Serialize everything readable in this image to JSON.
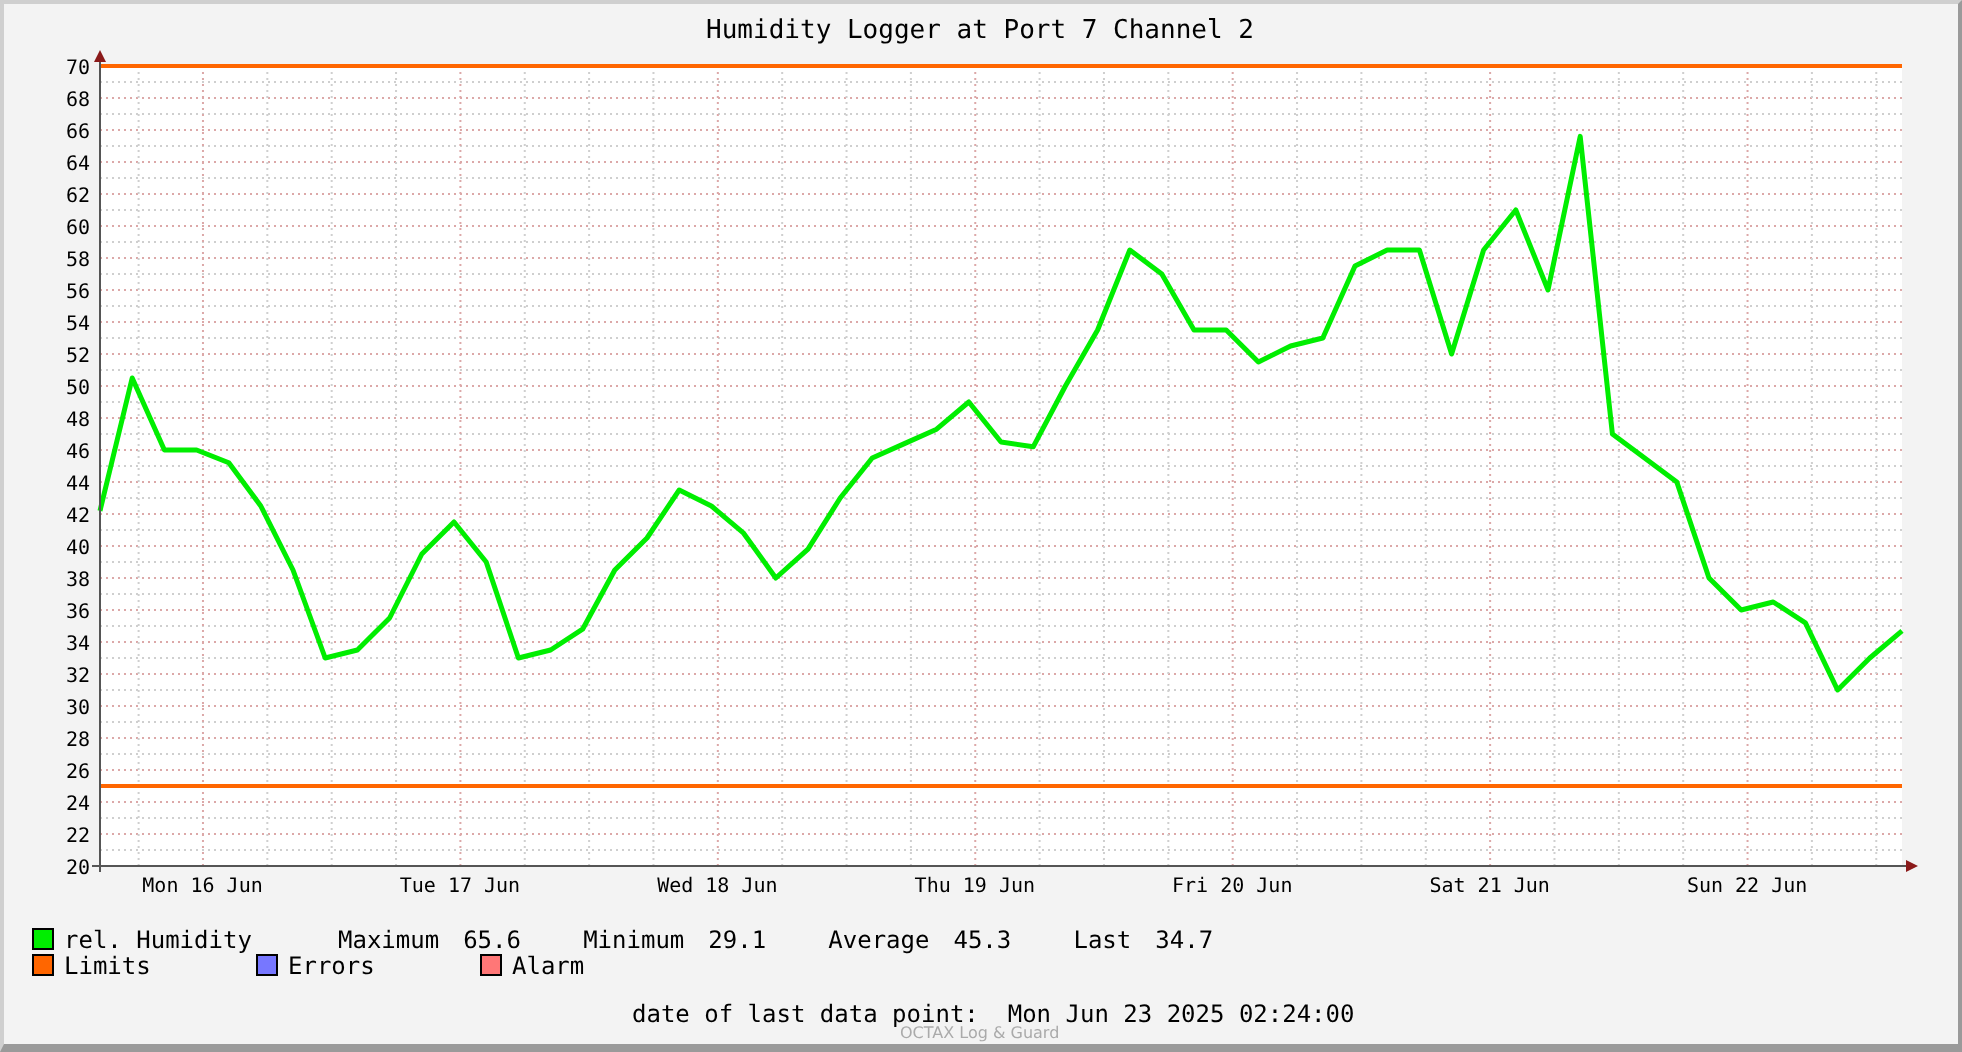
{
  "chart_data": {
    "type": "line",
    "title": "Humidity Logger at Port 7 Channel 2",
    "ylim": [
      20,
      70
    ],
    "categories": [
      null,
      null,
      null,
      "Mon 16 Jun",
      null,
      null,
      null,
      null,
      null,
      null,
      null,
      "Tue 17 Jun",
      null,
      null,
      null,
      null,
      null,
      null,
      null,
      "Wed 18 Jun",
      null,
      null,
      null,
      null,
      null,
      null,
      null,
      "Thu 19 Jun",
      null,
      null,
      null,
      null,
      null,
      null,
      null,
      "Fri 20 Jun",
      null,
      null,
      null,
      null,
      null,
      null,
      null,
      "Sat 21 Jun",
      null,
      null,
      null,
      null,
      null,
      null,
      null,
      "Sun 22 Jun",
      null,
      null,
      null,
      null,
      null
    ],
    "yticks": [
      20,
      22,
      24,
      26,
      28,
      30,
      32,
      34,
      36,
      38,
      40,
      42,
      44,
      46,
      48,
      50,
      52,
      54,
      56,
      58,
      60,
      62,
      64,
      66,
      68,
      70
    ],
    "series": [
      {
        "name": "rel. Humidity",
        "color": "#00ee00",
        "values": [
          42.2,
          50.5,
          46,
          46,
          45.2,
          42.5,
          38.5,
          33,
          33.5,
          35.5,
          39.5,
          41.5,
          39,
          33,
          33.5,
          34.8,
          38.5,
          40.5,
          43.5,
          42.5,
          40.8,
          38,
          39.8,
          43,
          45.5,
          46.4,
          47.3,
          49,
          46.5,
          46.2,
          50,
          53.5,
          58.5,
          57,
          53.5,
          53.5,
          51.5,
          52.5,
          53,
          57.5,
          58.5,
          58.5,
          52,
          58.5,
          61,
          56,
          65.6,
          47,
          45.5,
          44,
          38,
          36,
          36.5,
          35.2,
          31,
          33,
          34.7
        ]
      },
      {
        "name": "Limits",
        "color": "#ff6600",
        "values": [
          70,
          70,
          70,
          70,
          70,
          70,
          70,
          70,
          70,
          70,
          70,
          70,
          70,
          70,
          70,
          70,
          70,
          70,
          70,
          70,
          70,
          70,
          70,
          70,
          70,
          70,
          70,
          70,
          70,
          70,
          70,
          70,
          70,
          70,
          70,
          70,
          70,
          70,
          70,
          70,
          70,
          70,
          70,
          70,
          70,
          70,
          70,
          70,
          70,
          70,
          70,
          70,
          70,
          70,
          70,
          70,
          70
        ]
      },
      {
        "color": "#ff6600",
        "values": [
          25,
          25,
          25,
          25,
          25,
          25,
          25,
          25,
          25,
          25,
          25,
          25,
          25,
          25,
          25,
          25,
          25,
          25,
          25,
          25,
          25,
          25,
          25,
          25,
          25,
          25,
          25,
          25,
          25,
          25,
          25,
          25,
          25,
          25,
          25,
          25,
          25,
          25,
          25,
          25,
          25,
          25,
          25,
          25,
          25,
          25,
          25,
          25,
          25,
          25,
          25,
          25,
          25,
          25,
          25,
          25,
          25
        ]
      }
    ],
    "grid": true
  },
  "legend": [
    {
      "label": "Errors",
      "color": "#7777ff"
    },
    {
      "label": "Alarm",
      "color": "#ff7777"
    }
  ],
  "stats": [
    {
      "label": "Maximum",
      "value": "65.6"
    },
    {
      "label": "Minimum",
      "value": "29.1"
    },
    {
      "label": "Average",
      "value": "45.3"
    },
    {
      "label": "Last",
      "value": "34.7"
    }
  ],
  "last_point": {
    "label": "date of last data point:",
    "value": "Mon Jun 23 2025 02:24:00"
  },
  "watermark": "OCTAX Log & Guard"
}
